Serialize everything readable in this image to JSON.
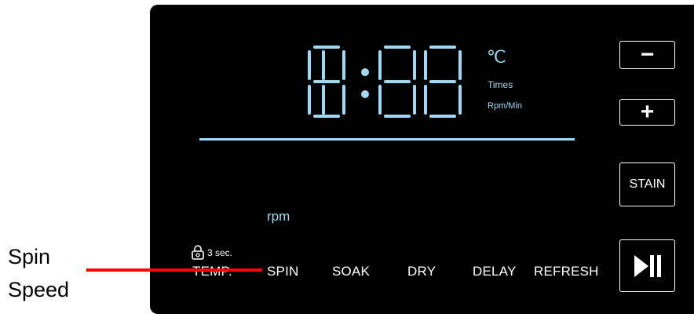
{
  "display": {
    "digits": [
      "1",
      "8",
      "8",
      "8"
    ],
    "units": {
      "celsius": "℃",
      "times": "Times",
      "rpm_min": "Rpm/Min"
    },
    "accent_color": "#9ed9f5"
  },
  "indicator": {
    "rpm": "rpm"
  },
  "lock": {
    "label": "3 sec.",
    "icon": "child-lock-icon"
  },
  "modes": [
    {
      "label": "TEMP."
    },
    {
      "label": "SPIN"
    },
    {
      "label": "SOAK"
    },
    {
      "label": "DRY"
    },
    {
      "label": "DELAY"
    },
    {
      "label": "REFRESH"
    }
  ],
  "buttons": {
    "minus": "−",
    "plus": "+",
    "stain": "STAIN",
    "play_pause_icon": "play-pause-icon"
  },
  "annotation": {
    "line1": "Spin",
    "line2": "Speed",
    "pointer_color": "#ff0000"
  }
}
